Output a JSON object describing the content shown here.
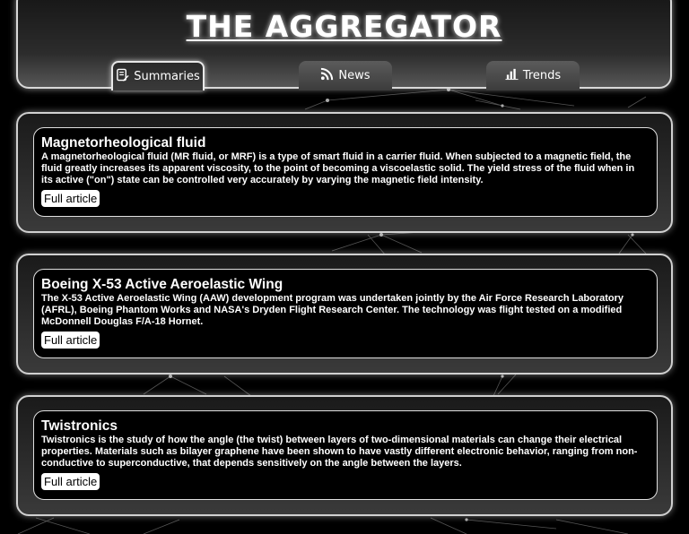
{
  "header": {
    "title": "THE AGGREGATOR",
    "tabs": [
      {
        "label": "Summaries",
        "icon": "summaries-icon",
        "active": true
      },
      {
        "label": "News",
        "icon": "rss-icon",
        "active": false
      },
      {
        "label": "Trends",
        "icon": "bar-chart-icon",
        "active": false
      }
    ]
  },
  "articles": [
    {
      "title": "Magnetorheological fluid",
      "summary": "A magnetorheological fluid (MR fluid, or MRF) is a type of smart fluid in a carrier fluid. When subjected to a magnetic field, the fluid greatly increases its apparent viscosity, to the point of becoming a viscoelastic solid. The yield stress of the fluid when in its active (\"on\") state can be controlled very accurately by varying the magnetic field intensity.",
      "link_label": "Full article"
    },
    {
      "title": "Boeing X-53 Active Aeroelastic Wing",
      "summary": "The X-53 Active Aeroelastic Wing (AAW) development program was undertaken jointly by the Air Force Research Laboratory (AFRL), Boeing Phantom Works and NASA's Dryden Flight Research Center. The technology was flight tested on a modified McDonnell Douglas F/A-18 Hornet.",
      "link_label": "Full article"
    },
    {
      "title": "Twistronics",
      "summary": "Twistronics is the study of how the angle (the twist) between layers of two-dimensional materials can change their electrical properties. Materials such as bilayer graphene have been shown to have vastly different electronic behavior, ranging from non-conductive to superconductive, that depends sensitively on the angle between the layers.",
      "link_label": "Full article"
    }
  ],
  "colors": {
    "background": "#000000",
    "panel_border": "#d8d8d8",
    "text": "#ffffff",
    "button_bg": "#ffffff",
    "button_text": "#000000"
  }
}
